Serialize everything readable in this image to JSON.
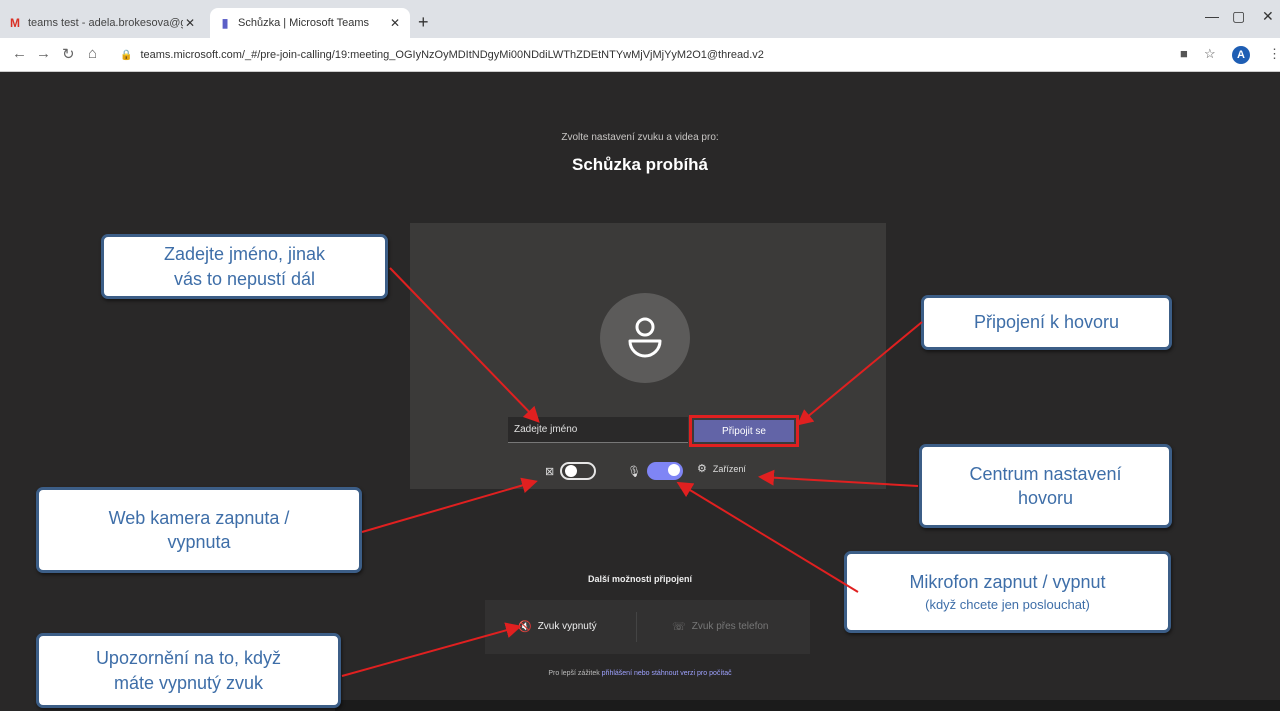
{
  "browser": {
    "tab1": {
      "title": "teams test - adela.brokesova@g",
      "icon": "gmail-icon"
    },
    "tab2": {
      "title": "Schůzka | Microsoft Teams",
      "icon": "teams-icon"
    },
    "url": "teams.microsoft.com/_#/pre-join-calling/19:meeting_OGIyNzOyMDItNDgyMi00NDdiLWThZDEtNTYwMjVjMjYyM2O1@thread.v2",
    "profile_initial": "A"
  },
  "prejoin": {
    "subtitle": "Zvolte nastavení zvuku a videa pro:",
    "title": "Schůzka probíhá",
    "name_placeholder": "Zadejte jméno",
    "join_label": "Připojit se",
    "camera_on": false,
    "mic_on": true,
    "settings_label": "Zařízení"
  },
  "more_options": {
    "title": "Další možnosti připojení",
    "audio_off_label": "Zvuk vypnutý",
    "phone_audio_label": "Zvuk přes telefon",
    "footer_prefix": "Pro lepší zážitek",
    "footer_link": "přihlášení nebo stáhnout verzi pro počítač"
  },
  "callouts": {
    "name": {
      "line1": "Zadejte jméno, jinak",
      "line2": "vás to nepustí dál"
    },
    "join": {
      "line1": "Připojení k hovoru"
    },
    "settings": {
      "line1": "Centrum nastavení",
      "line2": "hovoru"
    },
    "camera": {
      "line1": "Web kamera zapnuta /",
      "line2": "vypnuta"
    },
    "mic": {
      "line1": "Mikrofon zapnut / vypnut",
      "line2": "(když chcete jen poslouchat)"
    },
    "audio": {
      "line1": "Upozornění na to, když",
      "line2": "máte vypnutý zvuk"
    }
  },
  "colors": {
    "background": "#292828",
    "accent": "#6264a7",
    "highlight": "#e02020",
    "callout_text": "#3e6ea8",
    "arrow": "#e02020"
  }
}
